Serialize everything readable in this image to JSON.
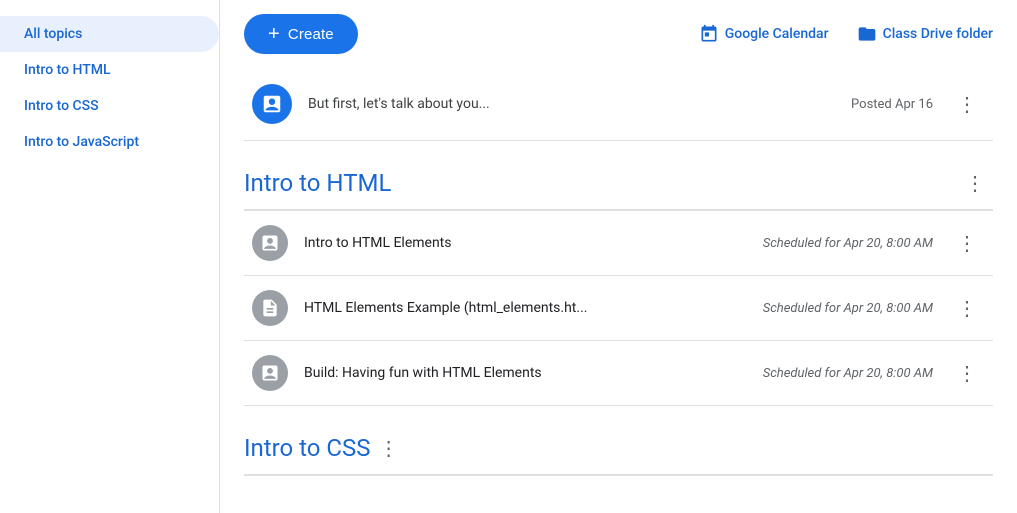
{
  "sidebar": {
    "items": [
      {
        "id": "all-topics",
        "label": "All topics",
        "active": true
      },
      {
        "id": "intro-html",
        "label": "Intro to HTML",
        "active": false
      },
      {
        "id": "intro-css",
        "label": "Intro to CSS",
        "active": false
      },
      {
        "id": "intro-js",
        "label": "Intro to JavaScript",
        "active": false
      }
    ]
  },
  "topbar": {
    "create_label": "Create",
    "google_calendar_label": "Google Calendar",
    "class_drive_label": "Class Drive folder"
  },
  "announcement": {
    "text": "But first, let's talk about you...",
    "meta": "Posted Apr 16"
  },
  "topic_html": {
    "title": "Intro to HTML",
    "assignments": [
      {
        "id": "html-elements",
        "name": "Intro to HTML Elements",
        "scheduled": "Scheduled for Apr 20, 8:00 AM",
        "icon_type": "assignment"
      },
      {
        "id": "html-example",
        "name": "HTML Elements Example (html_elements.ht...",
        "scheduled": "Scheduled for Apr 20, 8:00 AM",
        "icon_type": "file"
      },
      {
        "id": "html-build",
        "name": "Build: Having fun with HTML Elements",
        "scheduled": "Scheduled for Apr 20, 8:00 AM",
        "icon_type": "assignment"
      }
    ]
  },
  "topic_css": {
    "title": "Intro to CSS"
  },
  "icons": {
    "announcement_icon": "📋",
    "assignment_icon": "📄",
    "file_icon": "📄"
  }
}
